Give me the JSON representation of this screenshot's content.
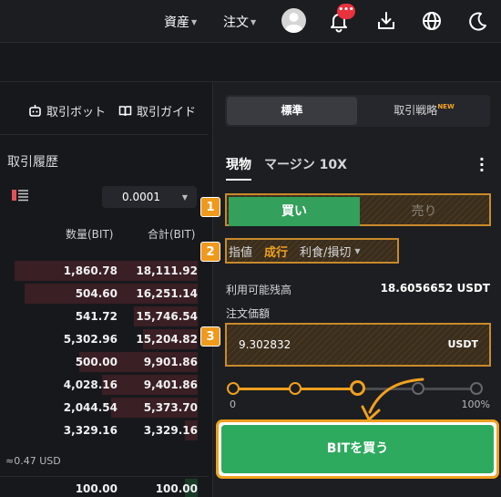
{
  "header": {
    "nav_assets": "資産",
    "nav_orders": "注文",
    "notification_badge": "•••"
  },
  "left": {
    "link_bot": "取引ボット",
    "link_guide": "取引ガイド",
    "history_title": "取引履歴",
    "precision": "0.0001",
    "col_qty": "数量(BIT)",
    "col_total": "合計(BIT)",
    "rows": [
      {
        "qty": "1,860.78",
        "total": "18,111.92"
      },
      {
        "qty": "504.60",
        "total": "16,251.14"
      },
      {
        "qty": "541.72",
        "total": "15,746.54"
      },
      {
        "qty": "5,302.96",
        "total": "15,204.82"
      },
      {
        "qty": "500.00",
        "total": "9,901.86"
      },
      {
        "qty": "4,028.16",
        "total": "9,401.86"
      },
      {
        "qty": "2,044.54",
        "total": "5,373.70"
      },
      {
        "qty": "3,329.16",
        "total": "3,329.16"
      }
    ],
    "usd_price": "≈0.47 USD",
    "bottom_row": {
      "qty": "100.00",
      "total": "100.00"
    }
  },
  "right": {
    "seg_standard": "標準",
    "seg_strategy": "取引戦略",
    "seg_new": "NEW",
    "tab_spot": "現物",
    "tab_margin": "マージン 10X",
    "buy_label": "買い",
    "sell_label": "売り",
    "type_limit": "指値",
    "type_market": "成行",
    "type_tpsl": "利食/損切",
    "available_label": "利用可能残高",
    "available_value": "18.6056652 USDT",
    "amount_label": "注文価額",
    "amount_value": "9.302832",
    "amount_unit": "USDT",
    "slider_min": "0",
    "slider_max": "100%",
    "slider_level": 0.5,
    "submit_label": "BITを買う",
    "step1": "1",
    "step2": "2",
    "step3": "3"
  },
  "colors": {
    "accent": "#f0a020",
    "buy": "#33a05c",
    "sell_bg": "#3a1f24"
  }
}
